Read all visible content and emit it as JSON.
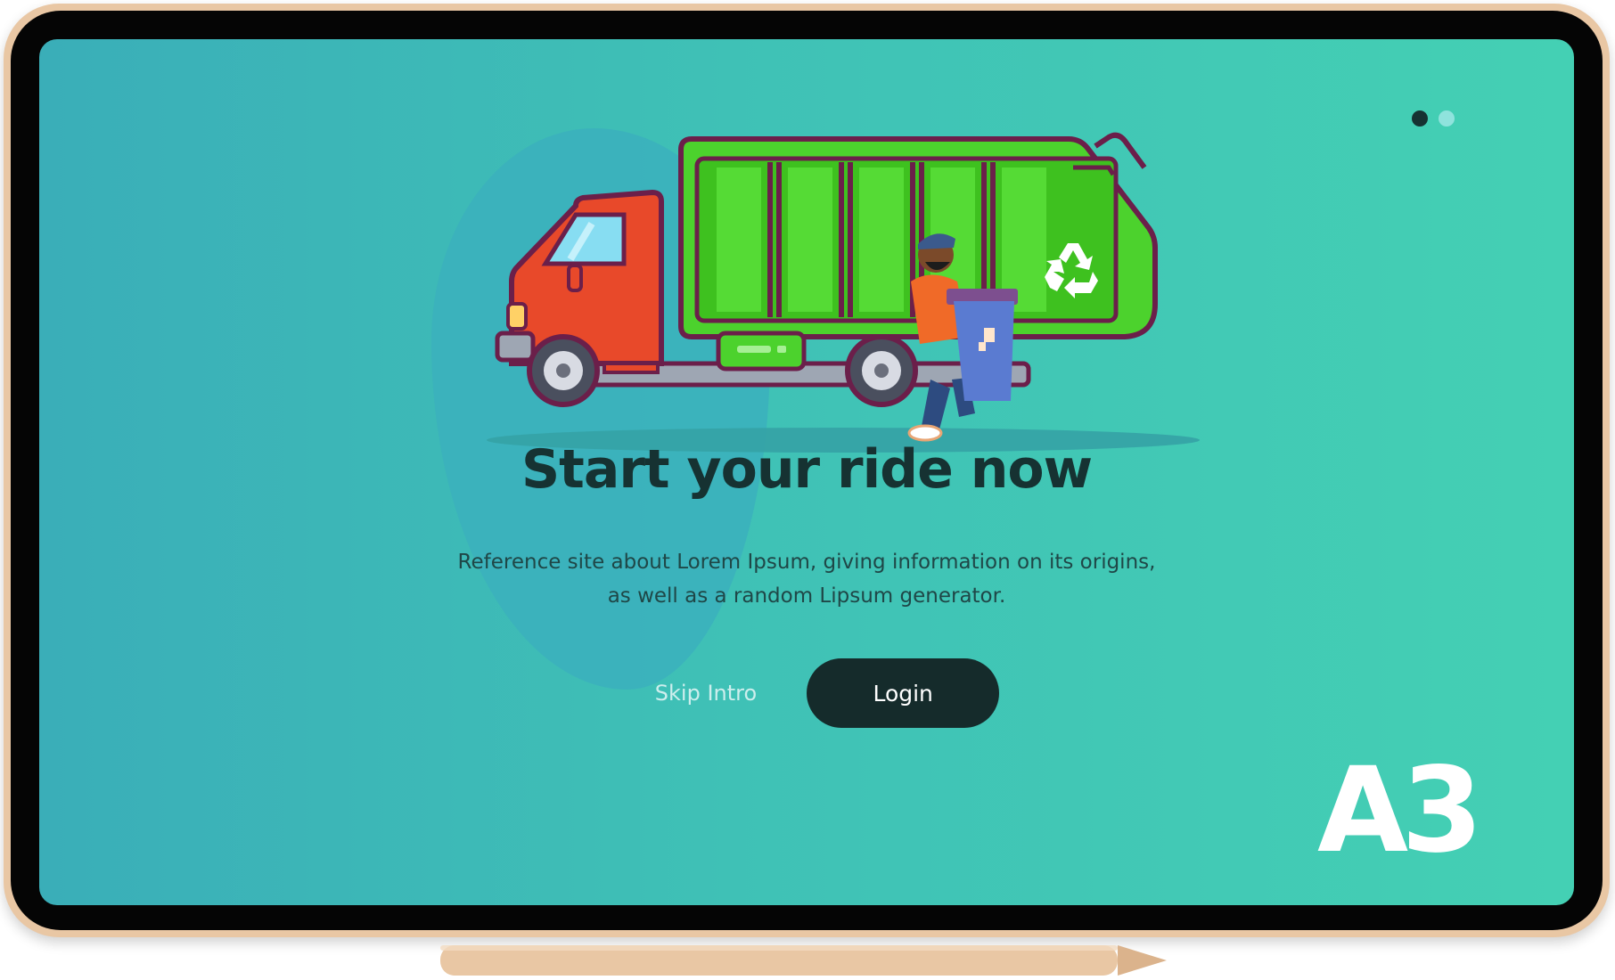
{
  "onboarding": {
    "title": "Start your ride now",
    "description_line1": "Reference site about Lorem Ipsum, giving information on its origins,",
    "description_line2": "as well as a random Lipsum generator.",
    "skip_label": "Skip Intro",
    "login_label": "Login",
    "pagination": {
      "total": 2,
      "active_index": 0
    }
  },
  "brand": {
    "logo_text": "A3"
  },
  "illustration": {
    "subject": "garbage-truck-with-worker",
    "icon": "recycle-icon"
  },
  "colors": {
    "background_left": "#3aaeb8",
    "background_right": "#44d0b4",
    "title": "#163232",
    "login_button": "#152b2b",
    "dot_active": "#163232",
    "dot_inactive": "#8fe3dd",
    "truck_cab": "#e8492a",
    "truck_container": "#52d434",
    "outline": "#6b1f4a"
  }
}
